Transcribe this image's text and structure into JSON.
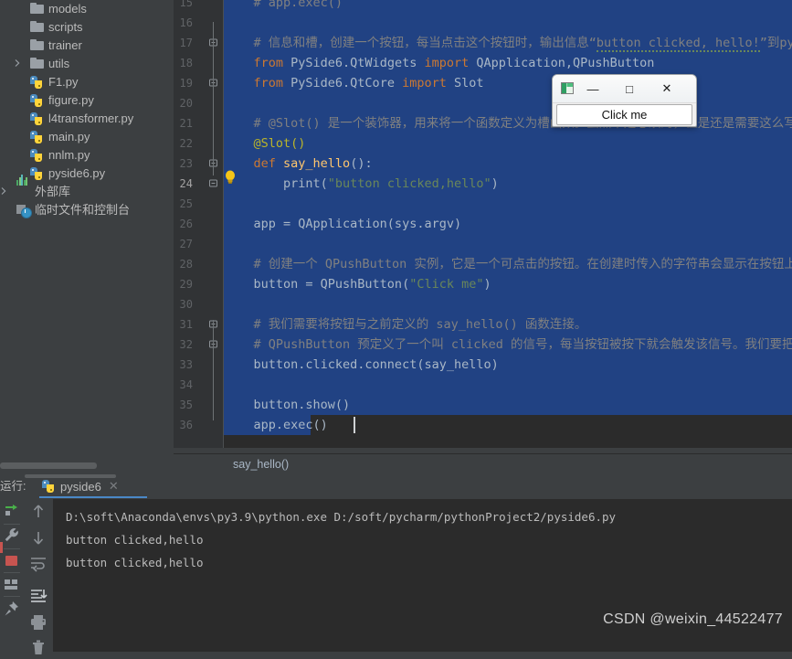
{
  "project_tree": {
    "items": [
      {
        "label": "models",
        "icon": "folder-icon",
        "indent": 33,
        "arrow": false,
        "type": "folder"
      },
      {
        "label": "scripts",
        "icon": "folder-icon",
        "indent": 33,
        "arrow": false,
        "type": "folder"
      },
      {
        "label": "trainer",
        "icon": "folder-icon",
        "indent": 33,
        "arrow": false,
        "type": "folder"
      },
      {
        "label": "utils",
        "icon": "folder-icon",
        "indent": 33,
        "arrow": true,
        "type": "folder"
      },
      {
        "label": "F1.py",
        "icon": "python-file-icon",
        "indent": 33,
        "arrow": false,
        "type": "py"
      },
      {
        "label": "figure.py",
        "icon": "python-file-icon",
        "indent": 33,
        "arrow": false,
        "type": "py"
      },
      {
        "label": "l4transformer.py",
        "icon": "python-file-icon",
        "indent": 33,
        "arrow": false,
        "type": "py"
      },
      {
        "label": "main.py",
        "icon": "python-file-icon",
        "indent": 33,
        "arrow": false,
        "type": "py"
      },
      {
        "label": "nnlm.py",
        "icon": "python-file-icon",
        "indent": 33,
        "arrow": false,
        "type": "py"
      },
      {
        "label": "pyside6.py",
        "icon": "python-file-icon",
        "indent": 33,
        "arrow": false,
        "type": "py"
      },
      {
        "label": "外部库",
        "icon": "external-libraries-icon",
        "indent": 18,
        "arrow": true,
        "type": "lib"
      },
      {
        "label": "临时文件和控制台",
        "icon": "scratches-consoles-icon",
        "indent": 18,
        "arrow": false,
        "type": "scratch"
      }
    ]
  },
  "editor": {
    "first_visible_line": 15,
    "current_line": 24,
    "caret_line": 36,
    "lines": [
      {
        "n": 15,
        "segments": [
          {
            "t": "    # app.exec()",
            "c": "tok-cm"
          }
        ],
        "fold": "",
        "selected": true
      },
      {
        "n": 16,
        "segments": [],
        "fold": "",
        "selected": true
      },
      {
        "n": 17,
        "segments": [
          {
            "t": "    # 信息和槽，创建一个按钮，每当点击这个按钮时，输出信息“",
            "c": "tok-cm"
          },
          {
            "t": "button clicked, hello!",
            "c": "tok-cm wavy-w"
          },
          {
            "t": "”到python控制台",
            "c": "tok-cm"
          }
        ],
        "fold": "top",
        "selected": true
      },
      {
        "n": 18,
        "segments": [
          {
            "t": "    from ",
            "c": "tok-kw"
          },
          {
            "t": "PySide6.QtWidgets ",
            "c": "tok-def"
          },
          {
            "t": "import ",
            "c": "tok-kw"
          },
          {
            "t": "QApplication,QPushButton",
            "c": "tok-def"
          }
        ],
        "fold": "",
        "selected": true
      },
      {
        "n": 19,
        "segments": [
          {
            "t": "    from ",
            "c": "tok-kw"
          },
          {
            "t": "PySide6.QtCore ",
            "c": "tok-def"
          },
          {
            "t": "import ",
            "c": "tok-kw"
          },
          {
            "t": "Slot",
            "c": "tok-def"
          }
        ],
        "fold": "top",
        "selected": true
      },
      {
        "n": 20,
        "segments": [],
        "fold": "",
        "selected": true
      },
      {
        "n": 21,
        "segments": [
          {
            "t": "    # @Slot() 是一个装饰器，用来将一个函数定义为槽函数。虽然不是必须的，但是还是需要这么写来区别",
            "c": "tok-cm"
          }
        ],
        "fold": "",
        "selected": true
      },
      {
        "n": 22,
        "segments": [
          {
            "t": "    @Slot()",
            "c": "tok-dec"
          }
        ],
        "fold": "",
        "selected": true
      },
      {
        "n": 23,
        "segments": [
          {
            "t": "    def ",
            "c": "tok-kw"
          },
          {
            "t": "say_hello",
            "c": "tok-fn"
          },
          {
            "t": "():",
            "c": "tok-def"
          }
        ],
        "fold": "top",
        "selected": true
      },
      {
        "n": 24,
        "segments": [
          {
            "t": "        print(",
            "c": "tok-def"
          },
          {
            "t": "\"button clicked,hello\"",
            "c": "tok-str"
          },
          {
            "t": ")",
            "c": "tok-def"
          }
        ],
        "fold": "bottom",
        "selected": true
      },
      {
        "n": 25,
        "segments": [],
        "fold": "",
        "selected": true
      },
      {
        "n": 26,
        "segments": [
          {
            "t": "    app = QApplication(sys.argv)",
            "c": "tok-def"
          }
        ],
        "fold": "",
        "selected": true
      },
      {
        "n": 27,
        "segments": [],
        "fold": "",
        "selected": true
      },
      {
        "n": 28,
        "segments": [
          {
            "t": "    # 创建一个 QPushButton 实例，它是一个可点击的按钮。在创建时传入的字符串会显示在按钮上：",
            "c": "tok-cm"
          }
        ],
        "fold": "",
        "selected": true
      },
      {
        "n": 29,
        "segments": [
          {
            "t": "    button = QPushButton(",
            "c": "tok-def"
          },
          {
            "t": "\"Click me\"",
            "c": "tok-str"
          },
          {
            "t": ")",
            "c": "tok-def"
          }
        ],
        "fold": "",
        "selected": true
      },
      {
        "n": 30,
        "segments": [],
        "fold": "",
        "selected": true
      },
      {
        "n": 31,
        "segments": [
          {
            "t": "    # 我们需要将按钮与之前定义的 say_hello() 函数连接。",
            "c": "tok-cm"
          }
        ],
        "fold": "top",
        "selected": true
      },
      {
        "n": 32,
        "segments": [
          {
            "t": "    # QPushButton 预定义了一个叫 clicked 的信号，每当按钮被按下就会触发该信号。我们要把这个信号",
            "c": "tok-cm"
          }
        ],
        "fold": "top",
        "selected": true
      },
      {
        "n": 33,
        "segments": [
          {
            "t": "    button.clicked.connect(say_hello)",
            "c": "tok-def"
          }
        ],
        "fold": "",
        "selected": true
      },
      {
        "n": 34,
        "segments": [],
        "fold": "",
        "selected": true
      },
      {
        "n": 35,
        "segments": [
          {
            "t": "    button.show()",
            "c": "tok-def"
          }
        ],
        "fold": "",
        "selected": true
      },
      {
        "n": 36,
        "segments": [
          {
            "t": "    app.exec()",
            "c": "tok-def"
          }
        ],
        "fold": "",
        "selected": true
      }
    ]
  },
  "breadcrumb": {
    "text": "say_hello()"
  },
  "qt_window": {
    "app_icon": "app-window-icon",
    "minimize_label": "—",
    "maximize_label": "□",
    "close_label": "✕",
    "button_label": "Click me"
  },
  "run_panel": {
    "title": "运行:",
    "tab_label": "pyside6",
    "tab_close": "✕",
    "console_lines": [
      "D:\\soft\\Anaconda\\envs\\py3.9\\python.exe D:/soft/pycharm/pythonProject2/pyside6.py",
      "button clicked,hello",
      "button clicked,hello"
    ],
    "toolbar_left_icons": [
      "rerun-icon",
      "settings-wrench-icon",
      "stop-icon",
      "layout-icon",
      "pin-icon"
    ],
    "toolbar_right_icons": [
      "scroll-up-icon",
      "scroll-down-icon",
      "soft-wrap-icon",
      "scroll-to-end-icon",
      "print-icon",
      "trash-icon"
    ]
  },
  "watermark": {
    "text": "CSDN @weixin_44522477"
  },
  "colors": {
    "editor_bg": "#2b2b2b",
    "gutter_bg": "#313335",
    "panel_bg": "#3c3f41",
    "selection": "#214283",
    "accent": "#4a88c7",
    "keyword": "#cc7832",
    "string": "#6a8759",
    "comment": "#808080",
    "function": "#ffc66d",
    "decorator": "#bbb529",
    "error": "#c75450"
  }
}
